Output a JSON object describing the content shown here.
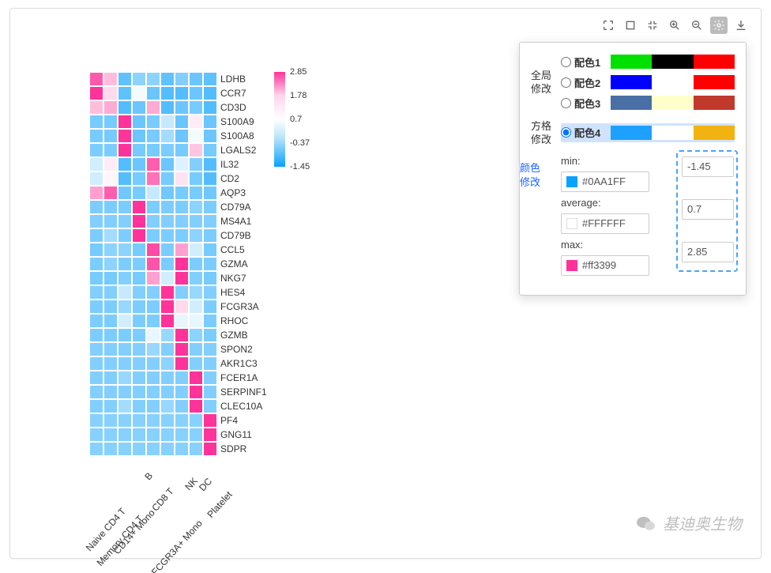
{
  "toolbar": {
    "icons": [
      "expand-icon",
      "fullscreen-icon",
      "collapse-icon",
      "zoom-in-icon",
      "zoom-out-icon",
      "gear-icon",
      "download-icon"
    ],
    "active": "gear-icon"
  },
  "popover": {
    "section_global": "全局修改",
    "label_global_l1": "全局",
    "label_global_l2": "修改",
    "label_grid_l1": "方格",
    "label_grid_l2": "修改",
    "label_color_l1": "颜色",
    "label_color_l2": "修改",
    "schemes": [
      {
        "name": "配色1",
        "selected": false,
        "colors": [
          "#00e000",
          "#000000",
          "#ff0000"
        ]
      },
      {
        "name": "配色2",
        "selected": false,
        "colors": [
          "#0000ff",
          "#ffffff",
          "#ff0000"
        ]
      },
      {
        "name": "配色3",
        "selected": false,
        "colors": [
          "#4a6fa5",
          "#ffffcc",
          "#c0392b"
        ]
      },
      {
        "name": "配色4",
        "selected": true,
        "colors": [
          "#1ea0ff",
          "#ffffff",
          "#f2b20f"
        ]
      }
    ],
    "min_label": "min:",
    "avg_label": "average:",
    "max_label": "max:",
    "min_color": "#0AA1FF",
    "avg_color": "#FFFFFF",
    "max_color": "#ff3399",
    "min_value": "-1.45",
    "avg_value": "0.7",
    "max_value": "2.85"
  },
  "legend_ticks": [
    "2.85",
    "1.78",
    "0.7",
    "-0.37",
    "-1.45"
  ],
  "watermark": "基迪奥生物",
  "chart_data": {
    "type": "heatmap",
    "title": "",
    "xlabel": "",
    "ylabel": "",
    "color_scale": {
      "min": -1.45,
      "mid": 0.7,
      "max": 2.85,
      "min_color": "#0AA1FF",
      "mid_color": "#FFFFFF",
      "max_color": "#ff3399"
    },
    "columns": [
      "Naive CD4 T",
      "Memory CD4 T",
      "CD14+ Mono",
      "B",
      "CD8 T",
      "FCGR3A+ Mono",
      "NK",
      "DC",
      "Platelet"
    ],
    "rows": [
      "LDHB",
      "CCR7",
      "CD3D",
      "S100A9",
      "S100A8",
      "LGALS2",
      "IL32",
      "CD2",
      "AQP3",
      "CD79A",
      "MS4A1",
      "CD79B",
      "CCL5",
      "GZMA",
      "NKG7",
      "HES4",
      "FCGR3A",
      "RHOC",
      "GZMB",
      "SPON2",
      "AKR1C3",
      "FCER1A",
      "SERPINF1",
      "CLEC10A",
      "PF4",
      "GNG11",
      "SDPR"
    ],
    "values": [
      [
        2.45,
        1.4,
        -0.7,
        -0.3,
        -0.3,
        -0.7,
        -0.4,
        -0.6,
        -0.7
      ],
      [
        2.85,
        1.1,
        -0.7,
        0.6,
        -0.6,
        -0.8,
        -0.8,
        -0.6,
        -0.8
      ],
      [
        1.4,
        1.6,
        -0.8,
        -0.6,
        1.6,
        -0.8,
        -0.6,
        -0.5,
        -0.8
      ],
      [
        -0.5,
        -0.5,
        2.85,
        -0.6,
        -0.5,
        0.2,
        -0.6,
        0.9,
        -0.6
      ],
      [
        -0.5,
        -0.5,
        2.85,
        -0.6,
        -0.5,
        -0.1,
        -0.6,
        0.6,
        -0.6
      ],
      [
        -0.45,
        -0.45,
        2.85,
        -0.5,
        -0.5,
        -0.45,
        -0.5,
        1.3,
        -0.5
      ],
      [
        0.3,
        0.9,
        -0.8,
        -0.6,
        2.4,
        -0.6,
        0.4,
        -0.4,
        -0.8
      ],
      [
        0.3,
        0.8,
        -0.8,
        -0.5,
        2.2,
        -0.5,
        1.0,
        -0.5,
        -0.8
      ],
      [
        1.7,
        2.4,
        -0.55,
        -0.5,
        0.2,
        -0.55,
        -0.5,
        -0.5,
        -0.55
      ],
      [
        -0.45,
        -0.45,
        -0.45,
        2.85,
        -0.45,
        -0.45,
        -0.45,
        -0.3,
        -0.45
      ],
      [
        -0.4,
        -0.4,
        -0.4,
        2.85,
        -0.4,
        -0.4,
        -0.4,
        -0.4,
        -0.4
      ],
      [
        -0.45,
        -0.1,
        -0.45,
        2.85,
        -0.45,
        -0.45,
        -0.45,
        -0.3,
        -0.45
      ],
      [
        -0.5,
        -0.3,
        -0.3,
        -0.5,
        2.6,
        -0.45,
        1.7,
        0.3,
        -0.5
      ],
      [
        -0.45,
        -0.3,
        -0.45,
        -0.45,
        2.5,
        -0.45,
        2.85,
        -0.45,
        -0.45
      ],
      [
        -0.5,
        -0.5,
        -0.4,
        -0.5,
        1.7,
        0.3,
        2.85,
        -0.4,
        -0.5
      ],
      [
        -0.4,
        -0.4,
        0.2,
        -0.4,
        -0.4,
        2.85,
        -0.4,
        -0.2,
        -0.4
      ],
      [
        -0.45,
        -0.45,
        -0.2,
        -0.45,
        -0.45,
        2.85,
        1.1,
        0.3,
        -0.45
      ],
      [
        -0.45,
        -0.45,
        0.3,
        -0.45,
        -0.45,
        2.85,
        0.5,
        0.5,
        -0.45
      ],
      [
        -0.45,
        -0.45,
        -0.45,
        -0.45,
        0.5,
        -0.2,
        2.85,
        -0.3,
        -0.45
      ],
      [
        -0.4,
        -0.4,
        -0.4,
        -0.4,
        -0.2,
        -0.4,
        2.85,
        -0.4,
        -0.4
      ],
      [
        -0.4,
        -0.4,
        -0.4,
        -0.4,
        -0.4,
        -0.3,
        2.85,
        -0.4,
        -0.4
      ],
      [
        -0.4,
        -0.4,
        -0.2,
        -0.4,
        -0.4,
        -0.4,
        -0.4,
        2.85,
        -0.4
      ],
      [
        -0.4,
        -0.4,
        -0.4,
        -0.4,
        -0.4,
        -0.4,
        -0.4,
        2.85,
        -0.4
      ],
      [
        -0.4,
        -0.4,
        -0.1,
        -0.4,
        -0.4,
        -0.2,
        -0.4,
        2.85,
        -0.4
      ],
      [
        -0.35,
        -0.35,
        -0.35,
        -0.35,
        -0.35,
        -0.35,
        -0.35,
        -0.35,
        2.85
      ],
      [
        -0.35,
        -0.35,
        -0.35,
        -0.35,
        -0.35,
        -0.35,
        -0.35,
        -0.35,
        2.85
      ],
      [
        -0.35,
        -0.35,
        -0.35,
        -0.35,
        -0.35,
        -0.35,
        -0.35,
        -0.35,
        2.85
      ]
    ]
  }
}
